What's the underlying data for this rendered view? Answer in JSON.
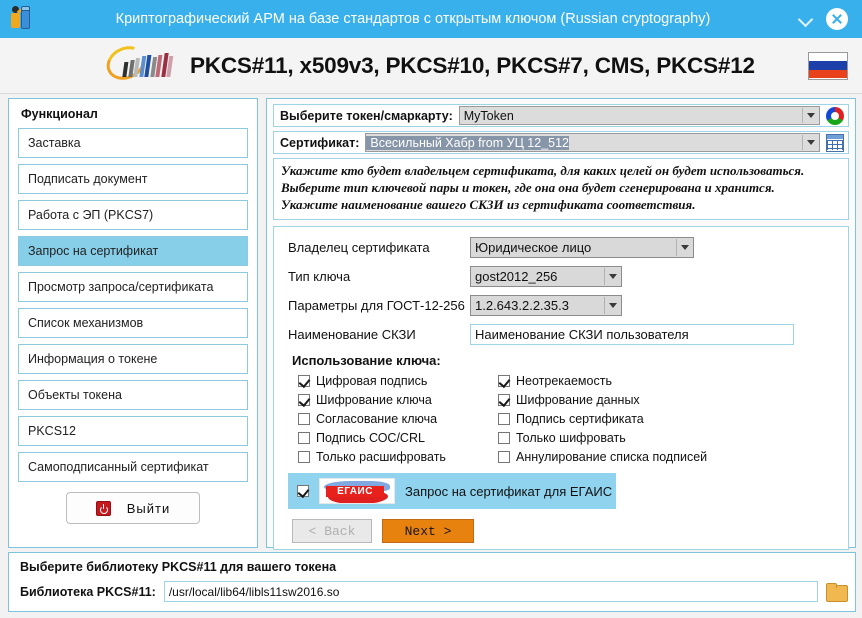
{
  "window": {
    "title": "Криптографический АРМ на базе стандартов с открытым ключом (Russian cryptography)",
    "app_icon": "person-token-icon",
    "minimize_icon": "chevron-down-icon",
    "close_icon": "close-icon"
  },
  "header": {
    "title": "PKCS#11, x509v3, PKCS#10, PKCS#7, CMS, PKCS#12",
    "logo_icon": "app-logo-icon",
    "flag_icon": "russian-flag-icon",
    "accent_blue": "#38b0ec"
  },
  "sidebar": {
    "title": "Функционал",
    "items": [
      {
        "label": "Заставка",
        "selected": false
      },
      {
        "label": "Подписать документ",
        "selected": false
      },
      {
        "label": "Работа с ЭП (PKCS7)",
        "selected": false
      },
      {
        "label": "Запрос на сертификат",
        "selected": true
      },
      {
        "label": "Просмотр запроса/сертификата",
        "selected": false
      },
      {
        "label": "Список механизмов",
        "selected": false
      },
      {
        "label": "Информация о токене",
        "selected": false
      },
      {
        "label": "Объекты токена",
        "selected": false
      },
      {
        "label": "PKCS12",
        "selected": false
      },
      {
        "label": "Самоподписанный сертификат",
        "selected": false
      }
    ],
    "exit_button": {
      "label": "Выйти",
      "icon": "power-off-icon"
    },
    "selected_color": "#87cfe9"
  },
  "main": {
    "token_row": {
      "label": "Выберите токен/смаркарту:",
      "value": "MyToken",
      "icon": "color-ring-icon"
    },
    "certificate_row": {
      "label": "Сертификат:",
      "value": "Всесильный Хабр from УЦ 12_512",
      "icon": "certificate-table-icon"
    },
    "instructions": [
      "Укажите кто будет владельцем сертификата, для каких целей он будет использоваться.",
      "Выберите тип ключевой пары и токен, где она она будет сгенерирована и хранится.",
      "Укажите наименование вашего СКЗИ из сертификата соответствия."
    ],
    "fields": [
      {
        "label": "Владелец сертификата",
        "value": "Юридическое лицо",
        "type": "select"
      },
      {
        "label": "Тип ключа",
        "value": "gost2012_256",
        "type": "select"
      },
      {
        "label": "Параметры для ГОСТ-12-256",
        "value": "1.2.643.2.2.35.3",
        "type": "select"
      },
      {
        "label": "Наименование СКЗИ",
        "value": "Наименование СКЗИ пользователя",
        "type": "text"
      }
    ],
    "usage_title": "Использование ключа:",
    "usage_checkboxes": [
      {
        "label": "Цифровая подпись",
        "checked": true
      },
      {
        "label": "Неотрекаемость",
        "checked": true
      },
      {
        "label": "Шифрование ключа",
        "checked": true
      },
      {
        "label": "Шифрование данных",
        "checked": true
      },
      {
        "label": "Согласование ключа",
        "checked": false
      },
      {
        "label": "Подпись сертификата",
        "checked": false
      },
      {
        "label": "Подпись СОС/CRL",
        "checked": false
      },
      {
        "label": "Только шифровать",
        "checked": false
      },
      {
        "label": "Только расшифровать",
        "checked": false
      },
      {
        "label": "Аннулирование списка подписей",
        "checked": false
      }
    ],
    "egais": {
      "checked": true,
      "logo_text": "ЕГАИС",
      "label": "Запрос на сертификат для ЕГАИС"
    },
    "nav": {
      "back_label": "< Back",
      "back_disabled": true,
      "next_label": "Next >",
      "next_color": "#e8820e"
    }
  },
  "footer": {
    "title": "Выберите библиотеку PKCS#11 для вашего токена",
    "label": "Библиотека PKCS#11:",
    "value": "/usr/local/lib64/libls11sw2016.so",
    "browse_icon": "folder-icon"
  }
}
